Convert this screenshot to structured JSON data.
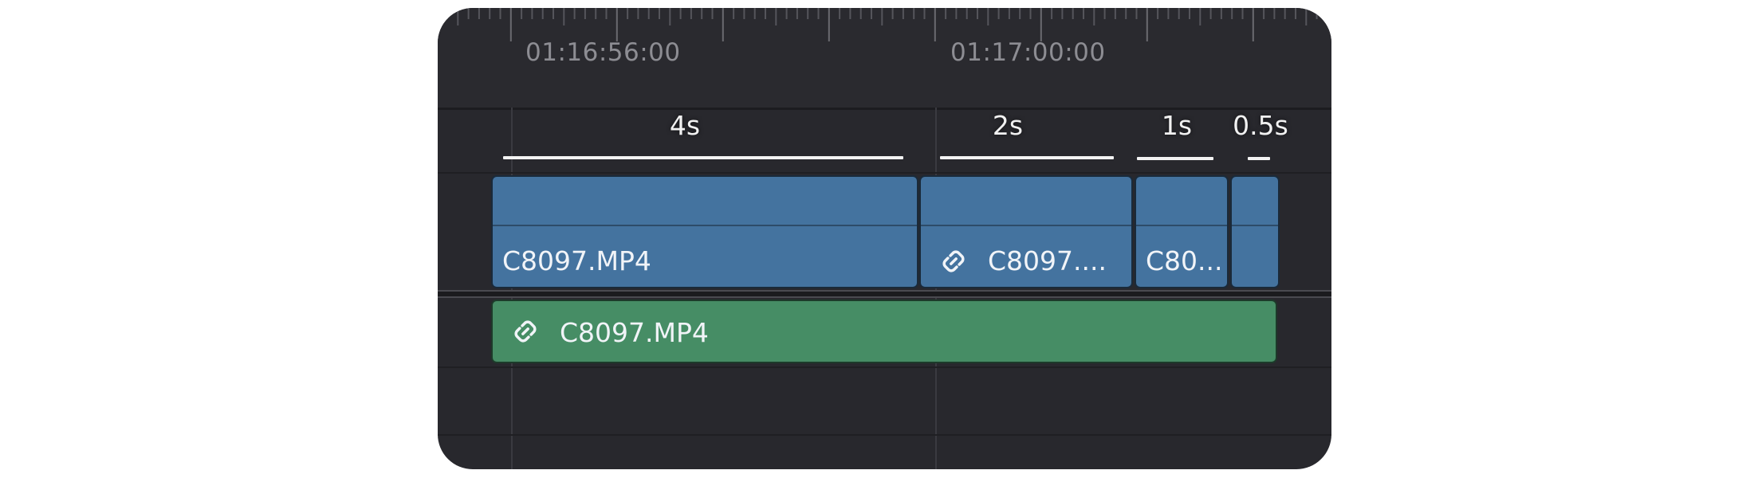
{
  "ruler": {
    "timecodes": [
      "01:16:56:00",
      "01:17:00:00"
    ]
  },
  "segments": [
    {
      "label": "4s"
    },
    {
      "label": "2s"
    },
    {
      "label": "1s"
    },
    {
      "label": "0.5s"
    }
  ],
  "video_track": {
    "clips": [
      {
        "name": "C8097.MP4",
        "linked": false
      },
      {
        "name": "C8097....",
        "linked": true
      },
      {
        "name": "C80...",
        "linked": false
      },
      {
        "name": "",
        "linked": false
      }
    ]
  },
  "audio_track": {
    "clips": [
      {
        "name": "C8097.MP4",
        "linked": true
      }
    ]
  },
  "colors": {
    "video_clip": "#44739f",
    "audio_clip": "#468d65",
    "panel_bg": "#28282d"
  },
  "icons": {
    "link": "link-icon"
  }
}
